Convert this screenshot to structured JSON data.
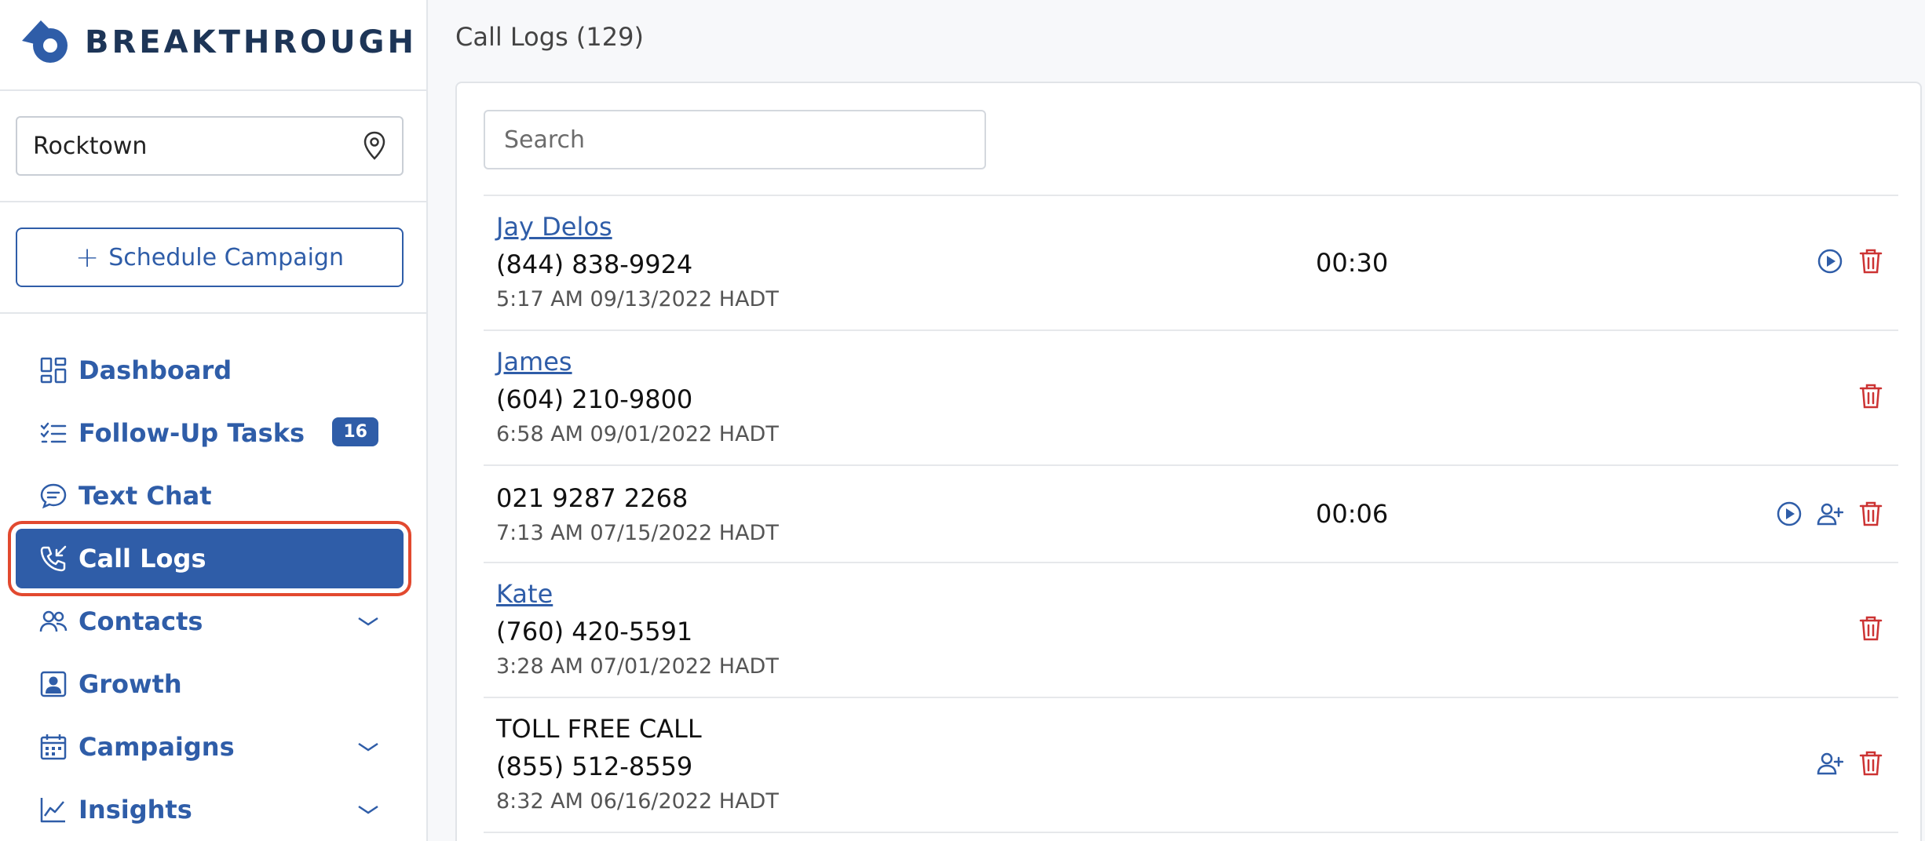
{
  "app": {
    "brand": "BREAKTHROUGH",
    "accent_color": "#2f5da8",
    "danger_color": "#cc3333"
  },
  "sidebar": {
    "location": "Rocktown",
    "schedule_label": "Schedule Campaign",
    "nav": [
      {
        "label": "Dashboard",
        "icon": "dashboard-icon"
      },
      {
        "label": "Follow-Up Tasks",
        "icon": "tasks-list-icon",
        "badge": "16"
      },
      {
        "label": "Text Chat",
        "icon": "chat-bubble-icon"
      },
      {
        "label": "Call Logs",
        "icon": "phone-incoming-icon",
        "active": true
      },
      {
        "label": "Contacts",
        "icon": "people-icon",
        "expandable": true
      },
      {
        "label": "Growth",
        "icon": "portrait-icon"
      },
      {
        "label": "Campaigns",
        "icon": "calendar-icon",
        "expandable": true
      },
      {
        "label": "Insights",
        "icon": "line-chart-icon",
        "expandable": true
      }
    ]
  },
  "main": {
    "title": "Call Logs (129)",
    "search_placeholder": "Search",
    "rows": [
      {
        "name": "Jay Delos",
        "phone": "(844) 838-9924",
        "time": "5:17 AM 09/13/2022 HADT",
        "duration": "00:30",
        "actions": [
          "play",
          "delete"
        ]
      },
      {
        "name": "James",
        "phone": "(604) 210-9800",
        "time": "6:58 AM 09/01/2022 HADT",
        "duration": "",
        "actions": [
          "delete"
        ]
      },
      {
        "name": "",
        "phone": "021 9287 2268",
        "time": "7:13 AM 07/15/2022 HADT",
        "duration": "00:06",
        "actions": [
          "play",
          "add-contact",
          "delete"
        ]
      },
      {
        "name": "Kate",
        "phone": "(760) 420-5591",
        "time": "3:28 AM 07/01/2022 HADT",
        "duration": "",
        "actions": [
          "delete"
        ]
      },
      {
        "name": "TOLL FREE CALL",
        "phone": "(855) 512-8559",
        "time": "8:32 AM 06/16/2022 HADT",
        "duration": "",
        "actions": [
          "add-contact",
          "delete"
        ]
      }
    ]
  }
}
